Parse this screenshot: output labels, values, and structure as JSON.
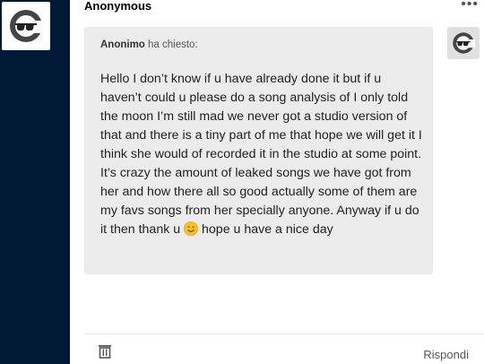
{
  "post": {
    "author": "Anonymous",
    "more_icon": "more-icon",
    "ask": {
      "asker_name": "Anonimo",
      "asker_suffix": " ha chiesto:",
      "question_part1": "Hello I don’t know if u have already done it but if u haven’t could u please do a song analysis of I only told the moon I’m still mad we never got a studio version of that and there is a tiny part of me that hope we will get it I think she would of recorded it in the studio at some point. It’s crazy the amount of leaked songs we have got from her and how there all so good actually some of them are my favs songs from her specially anyone. Anyway if u do it then thank u ",
      "emoji": "smiling-face-emoji",
      "question_part2": " hope u have a nice day"
    },
    "footer": {
      "delete_icon": "trash-icon",
      "reply_label": "Rispondi"
    }
  },
  "colors": {
    "sidebar": "#001935",
    "ask_background": "#ebebeb"
  }
}
